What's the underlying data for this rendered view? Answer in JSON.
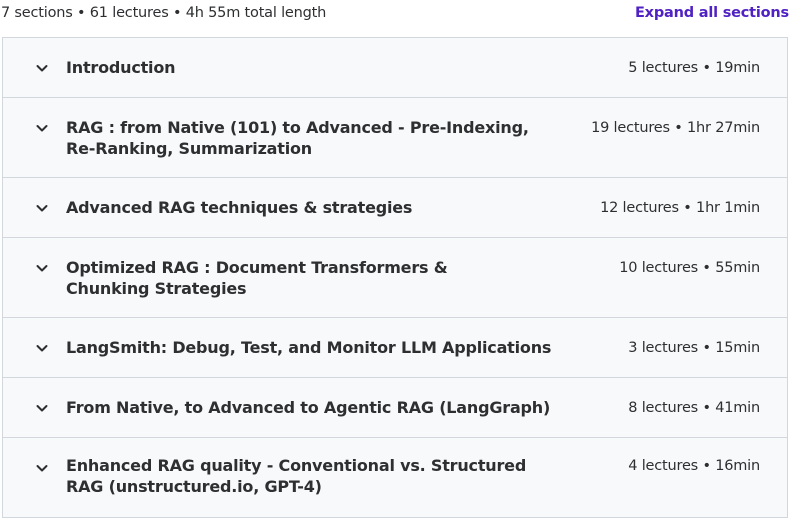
{
  "summary": {
    "text": "7 sections • 61 lectures • 4h 55m total length",
    "expand_label": "Expand all sections"
  },
  "sections": [
    {
      "title": "Introduction",
      "meta": "5 lectures • 19min",
      "icon": "chevron-down-icon"
    },
    {
      "title": "RAG : from Native (101) to Advanced - Pre-Indexing, Re-Ranking, Summarization",
      "meta": "19 lectures • 1hr 27min",
      "icon": "chevron-down-icon"
    },
    {
      "title": "Advanced RAG techniques & strategies",
      "meta": "12 lectures • 1hr 1min",
      "icon": "chevron-down-icon"
    },
    {
      "title": "Optimized RAG : Document Transformers & Chunking Strategies",
      "meta": "10 lectures • 55min",
      "icon": "chevron-down-icon"
    },
    {
      "title": "LangSmith: Debug, Test, and Monitor LLM Applications",
      "meta": "3 lectures • 15min",
      "icon": "chevron-down-icon"
    },
    {
      "title": "From Native, to Advanced to Agentic RAG (LangGraph)",
      "meta": "8 lectures • 41min",
      "icon": "chevron-down-icon"
    },
    {
      "title": "Enhanced RAG quality - Conventional vs. Structured RAG (unstructured.io, GPT-4)",
      "meta": "4 lectures • 16min",
      "icon": "chevron-down-icon"
    }
  ]
}
